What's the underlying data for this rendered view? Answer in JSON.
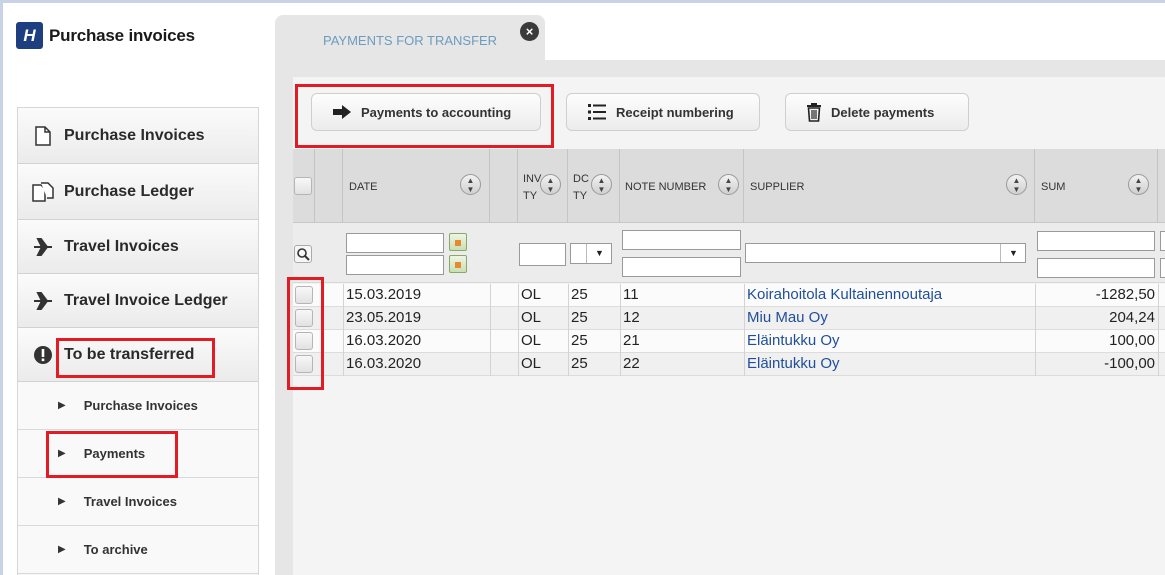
{
  "app": {
    "title": "Purchase invoices",
    "logo_letter": "H"
  },
  "sidebar": {
    "main_items": [
      {
        "label": "Purchase Invoices",
        "icon": "document-icon"
      },
      {
        "label": "Purchase Ledger",
        "icon": "documents-icon"
      },
      {
        "label": "Travel Invoices",
        "icon": "airplane-icon"
      },
      {
        "label": "Travel Invoice Ledger",
        "icon": "airplane-icon"
      },
      {
        "label": "To be transferred",
        "icon": "exclamation-icon"
      }
    ],
    "sub_items": [
      {
        "label": "Purchase Invoices"
      },
      {
        "label": "Payments"
      },
      {
        "label": "Travel Invoices"
      },
      {
        "label": "To archive"
      }
    ]
  },
  "tab": {
    "label": "PAYMENTS FOR TRANSFER",
    "close": "×"
  },
  "toolbar": {
    "to_accounting": "Payments to accounting",
    "receipt_numbering": "Receipt numbering",
    "delete_payments": "Delete payments"
  },
  "grid": {
    "headers": {
      "date": "DATE",
      "inv_type_1": "INV",
      "inv_type_2": "TY",
      "doc_type_1": "DC",
      "doc_type_2": "TY",
      "note_number": "NOTE NUMBER",
      "supplier": "SUPPLIER",
      "sum": "SUM"
    },
    "rows": [
      {
        "date": "15.03.2019",
        "inv_type": "OL",
        "doc_type": "25",
        "note": "11",
        "supplier": "Koirahoitola Kultainennoutaja",
        "sum": "-1282,50"
      },
      {
        "date": "23.05.2019",
        "inv_type": "OL",
        "doc_type": "25",
        "note": "12",
        "supplier": "Miu Mau Oy",
        "sum": "204,24"
      },
      {
        "date": "16.03.2020",
        "inv_type": "OL",
        "doc_type": "25",
        "note": "21",
        "supplier": "Eläintukku Oy",
        "sum": "100,00"
      },
      {
        "date": "16.03.2020",
        "inv_type": "OL",
        "doc_type": "25",
        "note": "22",
        "supplier": "Eläintukku Oy",
        "sum": "-100,00"
      }
    ]
  },
  "colors": {
    "highlight": "#e11c24",
    "brand": "#1e3f7f",
    "link": "#1f4f9a"
  }
}
